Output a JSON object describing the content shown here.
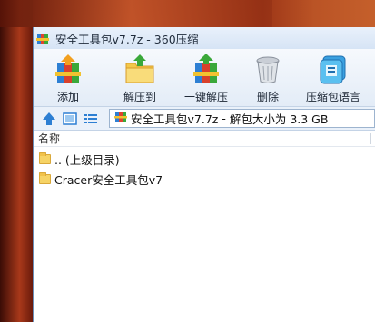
{
  "window": {
    "title": "安全工具包v7.7z - 360压缩"
  },
  "toolbar": {
    "items": [
      {
        "label": "添加",
        "icon": "add-books-icon"
      },
      {
        "label": "解压到",
        "icon": "extract-to-folder-icon"
      },
      {
        "label": "一键解压",
        "icon": "one-click-extract-icon"
      },
      {
        "label": "删除",
        "icon": "trash-bin-icon"
      },
      {
        "label": "压缩包语言",
        "icon": "archive-language-icon"
      }
    ]
  },
  "address": {
    "archive_name": "安全工具包v7.7z",
    "separator": "-",
    "info": "解包大小为 3.3 GB"
  },
  "list": {
    "column_name": "名称",
    "rows": [
      {
        "label": ".. (上级目录)"
      },
      {
        "label": "Cracer安全工具包v7"
      }
    ]
  },
  "colors": {
    "desktop": "#8a2410",
    "window_border": "#6c8fb8",
    "accent": "#2d7fd3"
  }
}
